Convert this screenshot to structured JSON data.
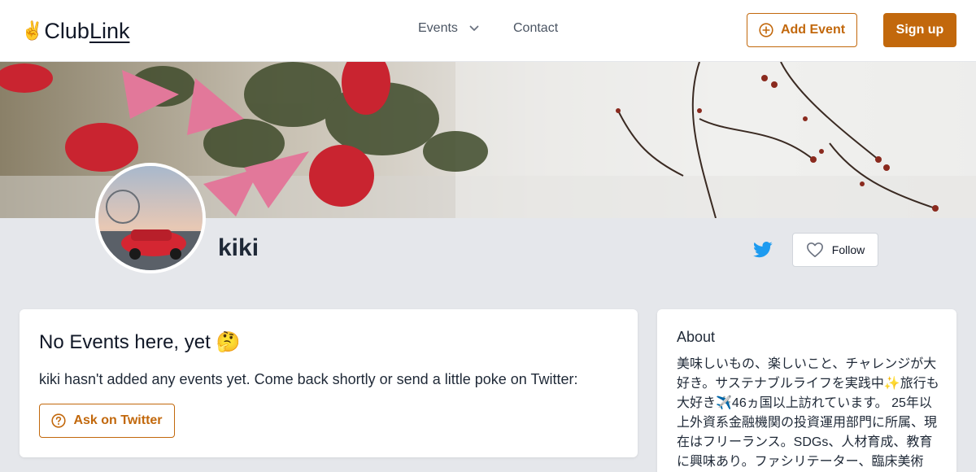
{
  "header": {
    "logo_emoji": "✌️",
    "logo_text_a": "Club",
    "logo_text_b": "Link",
    "nav": {
      "events_label": "Events",
      "contact_label": "Contact"
    },
    "add_event_label": "Add Event",
    "signup_label": "Sign up"
  },
  "profile": {
    "username": "kiki",
    "follow_label": "Follow"
  },
  "events_card": {
    "title": "No Events here, yet 🤔",
    "message": "kiki hasn't added any events yet. Come back shortly or send a little poke on Twitter:",
    "ask_label": "Ask on Twitter"
  },
  "about_card": {
    "title": "About",
    "bio": "美味しいもの、楽しいこと、チャレンジが大好き。サステナブルライフを実践中✨旅行も大好き✈️46ヵ国以上訪れています。 25年以上外資系金融機関の投資運用部門に所属、現在はフリーランス。SDGs、人材育成、教育に興味あり。ファシリテーター、臨床美術"
  },
  "colors": {
    "accent": "#c2680c",
    "twitter": "#1d9bf0",
    "page_bg": "#e5e7eb"
  },
  "icons": {
    "events_caret": "chevron-down-icon",
    "add_event": "plus-circle-icon",
    "twitter": "twitter-icon",
    "follow": "heart-icon",
    "ask": "question-circle-icon"
  }
}
